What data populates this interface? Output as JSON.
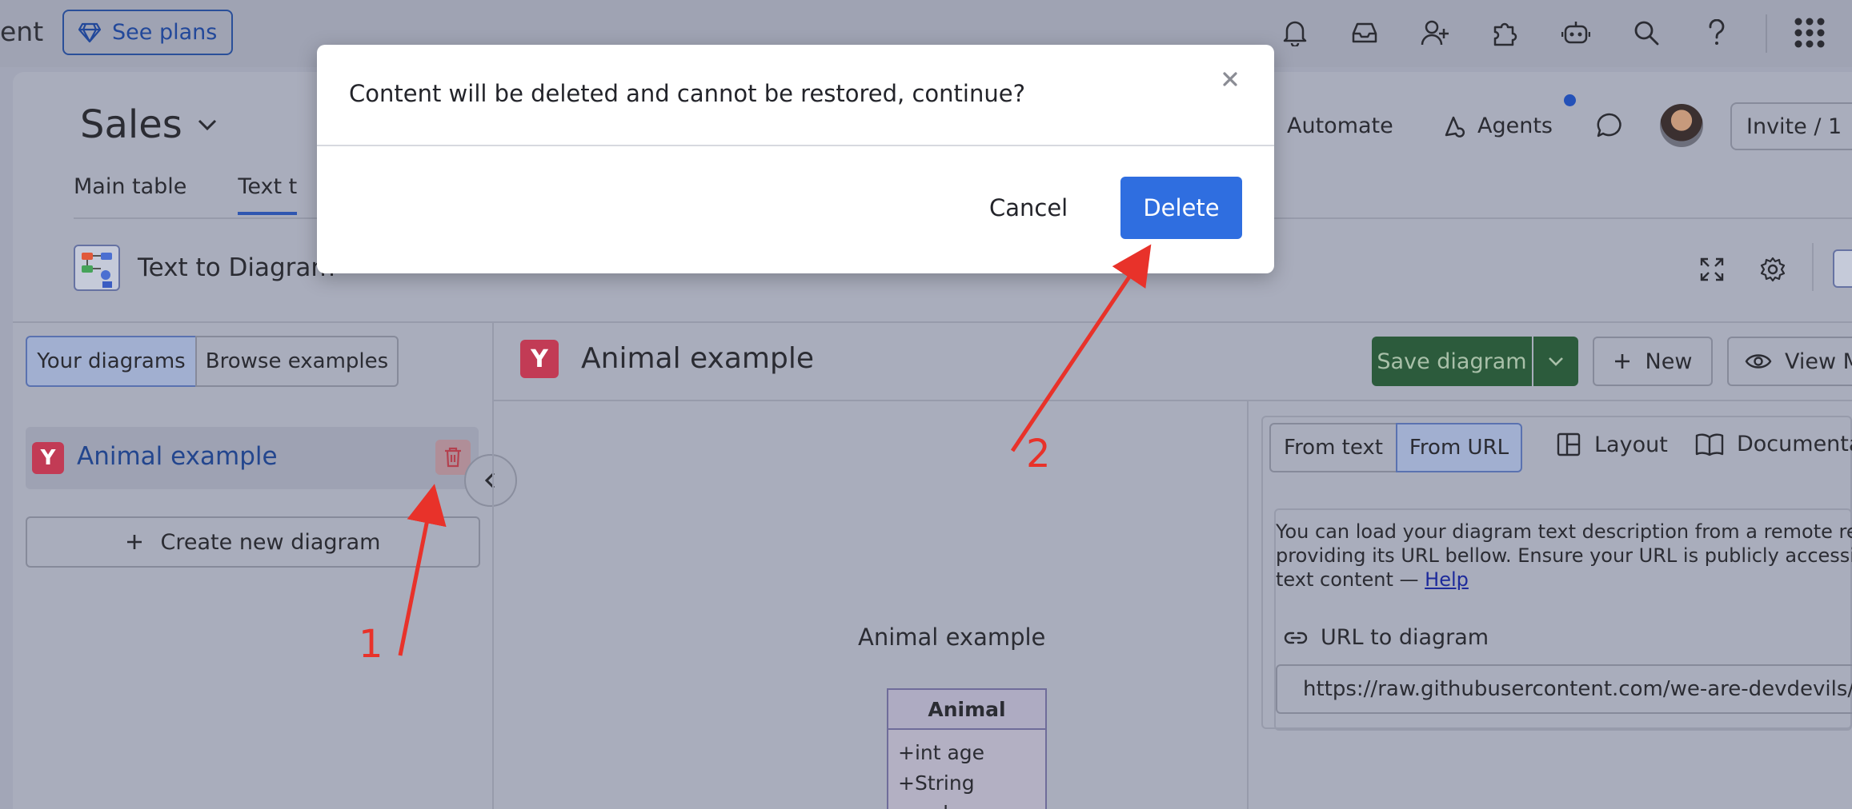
{
  "topbar": {
    "brand_fragment": "ent",
    "see_plans": "See plans"
  },
  "board": {
    "title": "Sales",
    "tabs": [
      "Main table",
      "Text to Diagram"
    ],
    "tab_visible_fragment": "Text t"
  },
  "header_actions": {
    "automate": "Automate",
    "agents": "Agents",
    "invite": "Invite / 1"
  },
  "app": {
    "title": "Text to Diagram"
  },
  "left_panel": {
    "segments": [
      "Your diagrams",
      "Browse examples"
    ],
    "active_segment": "Your diagrams",
    "diagram_item": "Animal example",
    "create_new": "Create new diagram"
  },
  "diagram_header": {
    "title": "Animal example",
    "save": "Save diagram",
    "new": "New",
    "view": "View M"
  },
  "canvas": {
    "title": "Animal example",
    "uml_class": {
      "name": "Animal",
      "attributes": [
        "+int age",
        "+String gender"
      ]
    }
  },
  "right_panel": {
    "segments": [
      "From text",
      "From URL"
    ],
    "active_segment": "From URL",
    "layout": "Layout",
    "documentation": "Documenta",
    "info_lines": [
      "You can load your diagram text description from a remote resou",
      "providing its URL bellow. Ensure your URL is publicly accessible",
      "text content — "
    ],
    "help_link": "Help",
    "url_label": "URL to diagram",
    "url_value": "https://raw.githubusercontent.com/we-are-devdevils/."
  },
  "modal": {
    "message": "Content will be deleted and cannot be restored, continue?",
    "cancel": "Cancel",
    "delete": "Delete"
  },
  "annotations": {
    "step1": "1",
    "step2": "2",
    "color": "#e8322a"
  },
  "icons": [
    "gem-icon",
    "bell-icon",
    "inbox-icon",
    "add-user-icon",
    "puzzle-icon",
    "robot-icon",
    "search-icon",
    "help-icon",
    "apps-grid-icon",
    "chevron-down-icon",
    "automate-icon",
    "agents-icon",
    "chat-icon",
    "expand-icon",
    "settings-icon",
    "trash-icon",
    "chevron-left-icon",
    "plus-icon",
    "eye-icon",
    "layout-icon",
    "book-icon",
    "link-icon",
    "close-icon"
  ]
}
